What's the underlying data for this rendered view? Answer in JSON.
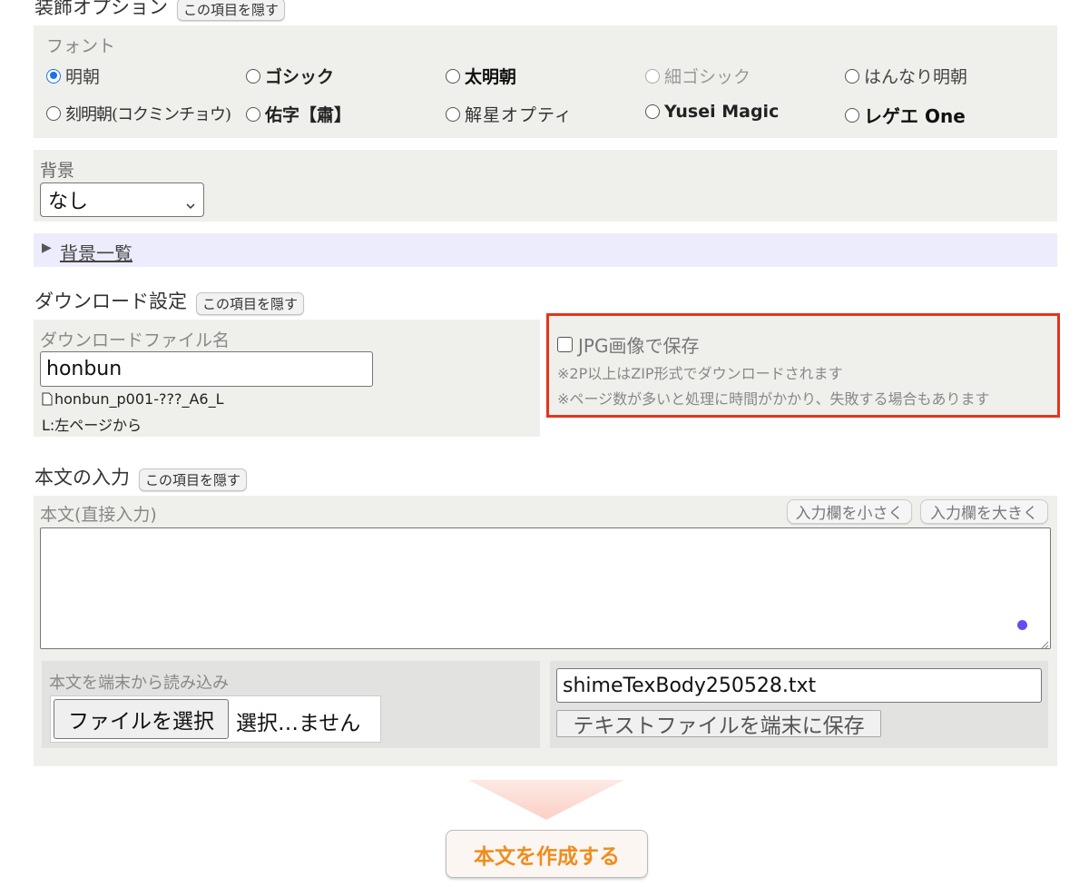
{
  "decoration": {
    "heading": "装飾オプション",
    "hide_label": "この項目を隠す",
    "font_label": "フォント",
    "fonts": [
      {
        "label": "明朝",
        "selected": true,
        "disabled": false
      },
      {
        "label": "ゴシック",
        "selected": false,
        "disabled": false
      },
      {
        "label": "太明朝",
        "selected": false,
        "disabled": false
      },
      {
        "label": "細ゴシック",
        "selected": false,
        "disabled": true
      },
      {
        "label": "はんなり明朝",
        "selected": false,
        "disabled": false
      },
      {
        "label": "刻明朝(コクミンチョウ)",
        "selected": false,
        "disabled": false
      },
      {
        "label": "佑字【肅】",
        "selected": false,
        "disabled": false
      },
      {
        "label": "解星オプティ",
        "selected": false,
        "disabled": false
      },
      {
        "label": "Yusei Magic",
        "selected": false,
        "disabled": false
      },
      {
        "label": "レゲエ One",
        "selected": false,
        "disabled": false
      }
    ],
    "background_label": "背景",
    "background_value": "なし",
    "background_list_link": "背景一覧"
  },
  "download": {
    "heading": "ダウンロード設定",
    "hide_label": "この項目を隠す",
    "filename_label": "ダウンロードファイル名",
    "filename_value": "honbun",
    "filename_preview": "honbun_p001-???_A6_L",
    "direction_note": "L:左ページから",
    "jpg_label": "JPG画像で保存",
    "jpg_checked": false,
    "jpg_note1": "※2P以上はZIP形式でダウンロードされます",
    "jpg_note2": "※ページ数が多いと処理に時間がかかり、失敗する場合もあります",
    "highlight_color": "#e8331c"
  },
  "body_input": {
    "heading": "本文の入力",
    "hide_label": "この項目を隠す",
    "direct_label": "本文(直接入力)",
    "shrink_label": "入力欄を小さく",
    "enlarge_label": "入力欄を大きく",
    "textarea_value": "",
    "load_label": "本文を端末から読み込み",
    "file_button": "ファイルを選択",
    "file_status": "選択…ません",
    "save_filename": "shimeTexBody250528.txt",
    "save_button": "テキストファイルを端末に保存"
  },
  "create_button": "本文を作成する",
  "colors": {
    "panel_bg": "#eff0ec",
    "link_panel_bg": "#ececfc",
    "accent_orange": "#f08c1e",
    "radio_blue": "#1a73e8"
  }
}
